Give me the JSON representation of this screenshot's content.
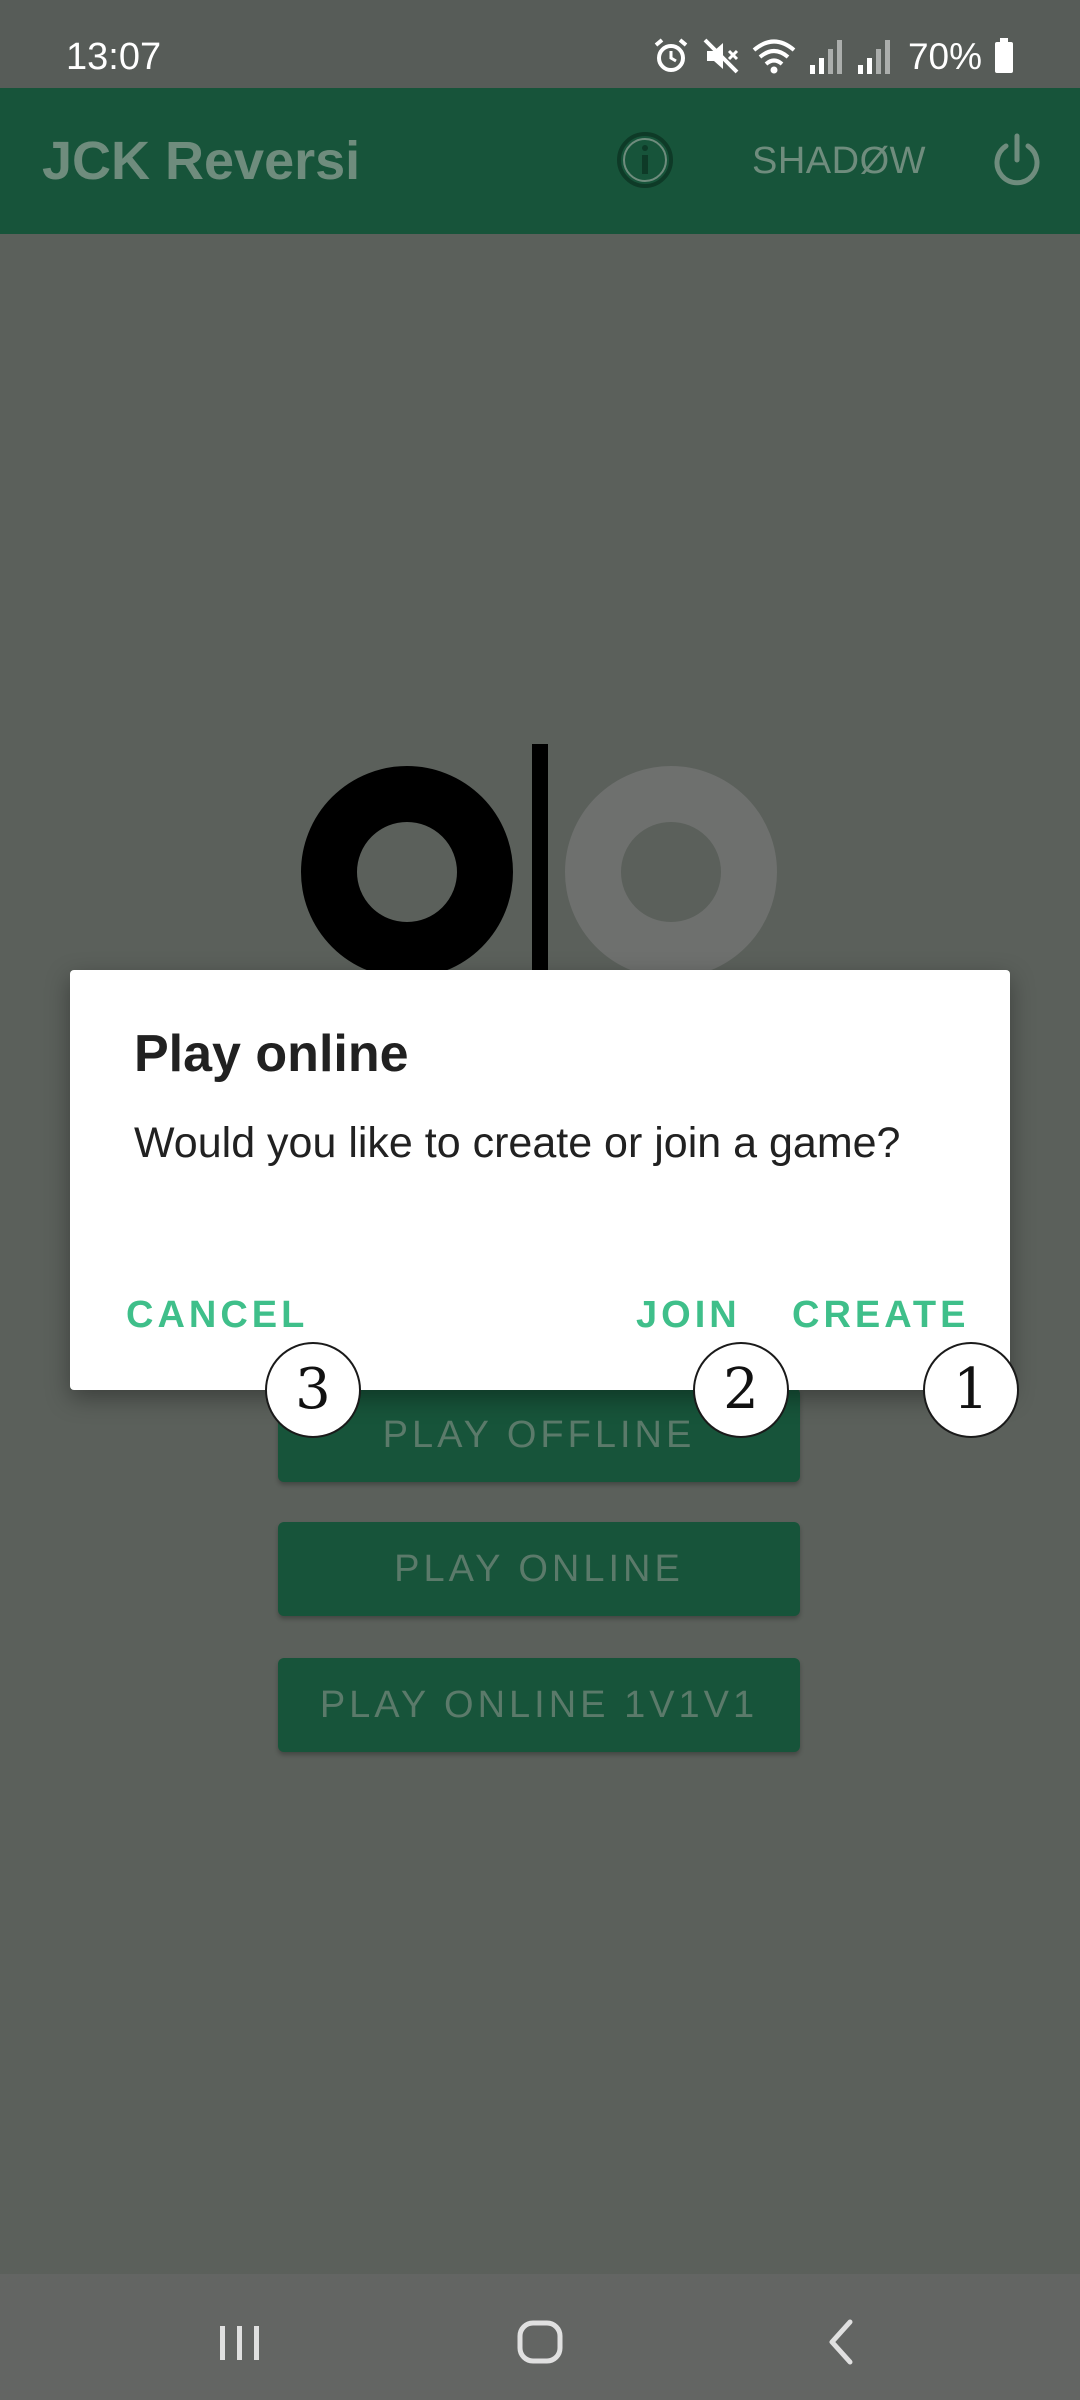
{
  "status_bar": {
    "time": "13:07",
    "battery": "70%",
    "icons": [
      "alarm-icon",
      "mute-icon",
      "wifi-icon",
      "signal-icon",
      "signal-icon",
      "battery-icon"
    ]
  },
  "app_bar": {
    "title": "JCK Reversi",
    "info_icon": "info-icon",
    "shadow_label": "SHADØW",
    "power_icon": "power-icon"
  },
  "menu": {
    "play_offline": "PLAY OFFLINE",
    "play_online": "PLAY ONLINE",
    "play_online_1v1v1": "PLAY ONLINE 1V1V1"
  },
  "dialog": {
    "title": "Play online",
    "message": "Would you like to create or join a game?",
    "cancel": "CANCEL",
    "join": "JOIN",
    "create": "CREATE"
  },
  "markers": {
    "one": "1",
    "two": "2",
    "three": "3"
  },
  "nav_bar": {
    "icons": [
      "recents-icon",
      "home-icon",
      "back-icon"
    ]
  },
  "colors": {
    "app_bar": "#17543a",
    "accent": "#3fbf8a",
    "scrim_background": "#5b605b",
    "dialog_background": "#ffffff"
  }
}
